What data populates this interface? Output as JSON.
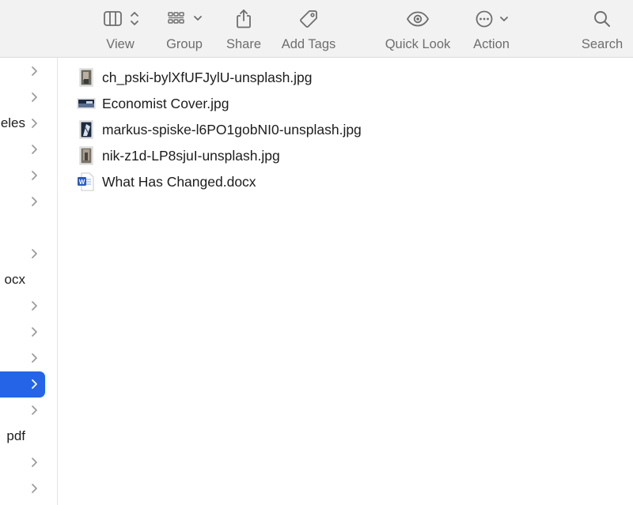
{
  "toolbar": {
    "view_label": "View",
    "group_label": "Group",
    "share_label": "Share",
    "add_tags_label": "Add Tags",
    "quick_look_label": "Quick Look",
    "action_label": "Action",
    "search_label": "Search"
  },
  "sidebar": {
    "rows": [
      {
        "text": "",
        "chevron": true
      },
      {
        "text": "",
        "chevron": true
      },
      {
        "text": "eles",
        "chevron": true
      },
      {
        "text": "",
        "chevron": true
      },
      {
        "text": "",
        "chevron": true
      },
      {
        "text": "",
        "chevron": true
      },
      {
        "text": "",
        "chevron": false
      },
      {
        "text": "",
        "chevron": true
      },
      {
        "text": "ocx",
        "chevron": false
      },
      {
        "text": "",
        "chevron": true
      },
      {
        "text": "",
        "chevron": true
      },
      {
        "text": "",
        "chevron": true
      },
      {
        "text": "",
        "chevron": true,
        "selected": true
      },
      {
        "text": "",
        "chevron": true
      },
      {
        "text": "pdf",
        "chevron": false
      },
      {
        "text": "",
        "chevron": true
      },
      {
        "text": "",
        "chevron": true
      }
    ]
  },
  "files": [
    {
      "name": "ch_pski-bylXfUFJylU-unsplash.jpg",
      "icon": "image-thumbnail-icon"
    },
    {
      "name": "Economist Cover.jpg",
      "icon": "image-thumbnail-icon"
    },
    {
      "name": "markus-spiske-l6PO1gobNI0-unsplash.jpg",
      "icon": "image-thumbnail-icon"
    },
    {
      "name": "nik-z1d-LP8sjuI-unsplash.jpg",
      "icon": "image-thumbnail-icon"
    },
    {
      "name": "What Has Changed.docx",
      "icon": "word-document-icon"
    }
  ],
  "colors": {
    "toolbar_bg": "#f3f2f2",
    "selection": "#2564e6",
    "icon_gray": "#6e6e6e"
  }
}
